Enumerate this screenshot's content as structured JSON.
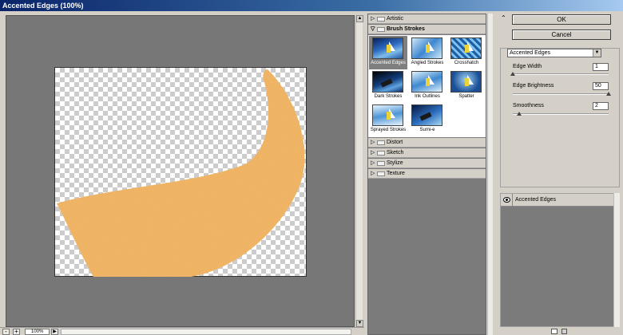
{
  "window": {
    "title": "Accented Edges (100%)"
  },
  "preview": {
    "zoom": "100%",
    "zoom_out": "-",
    "zoom_in": "+",
    "fill_color": "#f7b867"
  },
  "gallery": {
    "categories_top": [
      {
        "label": "Artistic",
        "state": "collapsed"
      },
      {
        "label": "Brush Strokes",
        "state": "expanded"
      }
    ],
    "filters": [
      {
        "label": "Accented Edges",
        "selected": true
      },
      {
        "label": "Angled Strokes",
        "selected": false
      },
      {
        "label": "Crosshatch",
        "selected": false
      },
      {
        "label": "Dark Strokes",
        "selected": false
      },
      {
        "label": "Ink Outlines",
        "selected": false
      },
      {
        "label": "Spatter",
        "selected": false
      },
      {
        "label": "Sprayed Strokes",
        "selected": false
      },
      {
        "label": "Sumi-e",
        "selected": false
      }
    ],
    "categories_bottom": [
      {
        "label": "Distort"
      },
      {
        "label": "Sketch"
      },
      {
        "label": "Stylize"
      },
      {
        "label": "Texture"
      }
    ]
  },
  "buttons": {
    "ok": "OK",
    "cancel": "Cancel"
  },
  "settings": {
    "filter_select": "Accented Edges",
    "params": [
      {
        "label": "Edge Width",
        "value": "1",
        "fraction": 0.0
      },
      {
        "label": "Edge Brightness",
        "value": "50",
        "fraction": 1.0
      },
      {
        "label": "Smoothness",
        "value": "2",
        "fraction": 0.07
      }
    ]
  },
  "layers": {
    "items": [
      {
        "label": "Accented Edges"
      }
    ]
  }
}
